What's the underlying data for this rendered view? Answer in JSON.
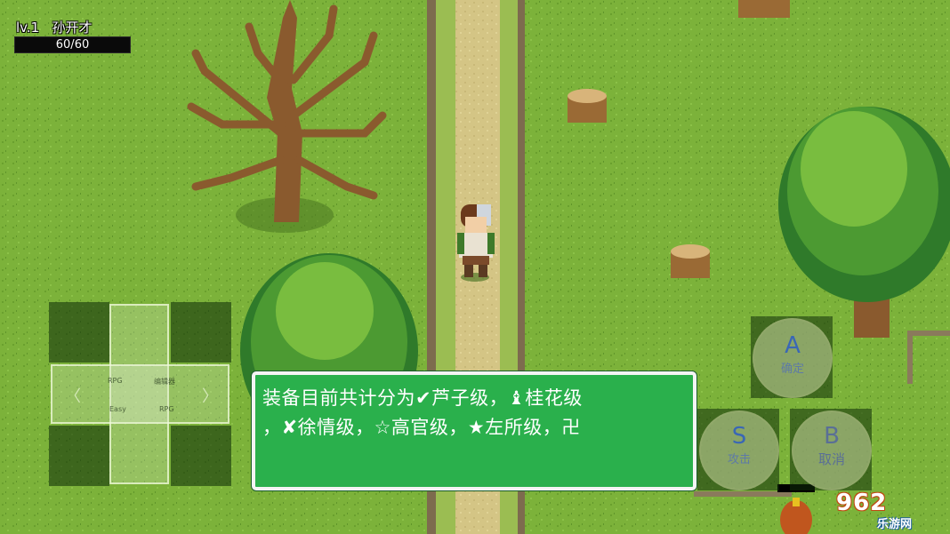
{
  "hud": {
    "level": "lv.1",
    "player_name": "孙开才",
    "hp_text": "60/60",
    "hp_fraction": 1.0
  },
  "dpad": {
    "tiny_labels": [
      "RPG",
      "编辑器",
      "Easy",
      "RPG"
    ]
  },
  "buttons": {
    "a": {
      "letter": "A",
      "caption": "确定"
    },
    "s": {
      "letter": "S",
      "caption": "攻击"
    },
    "b": {
      "letter": "B",
      "caption": "取消"
    }
  },
  "message": {
    "lines": [
      "装备目前共计分为✔芦子级，♝桂花级",
      "，✘徐情级，☆高官级，★左所级，卍"
    ]
  },
  "watermark": {
    "number": "962",
    "site": "乐游网"
  },
  "colors": {
    "grass": "#7cb23a",
    "path": "#d8c98a",
    "message_bg": "#2ab04c",
    "message_border": "#f4f4f4",
    "button_letter": "#3a67b5"
  }
}
